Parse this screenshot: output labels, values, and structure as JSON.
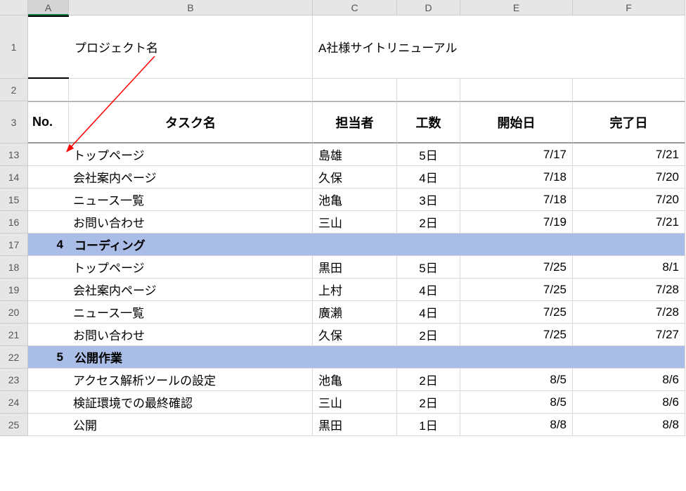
{
  "columns": [
    "A",
    "B",
    "C",
    "D",
    "E",
    "F"
  ],
  "project_label": "プロジェクト名",
  "project_name": "A社様サイトリニューアル",
  "header": {
    "no": "No.",
    "task": "タスク名",
    "assignee": "担当者",
    "effort": "工数",
    "start": "開始日",
    "end": "完了日"
  },
  "visible_rows": [
    "1",
    "2",
    "3",
    "13",
    "14",
    "15",
    "16",
    "17",
    "18",
    "19",
    "20",
    "21",
    "22",
    "23",
    "24",
    "25"
  ],
  "rows": [
    {
      "type": "data",
      "task": "トップページ",
      "assignee": "島雄",
      "effort": "5日",
      "start": "7/17",
      "end": "7/21"
    },
    {
      "type": "data",
      "task": "会社案内ページ",
      "assignee": "久保",
      "effort": "4日",
      "start": "7/18",
      "end": "7/20"
    },
    {
      "type": "data",
      "task": "ニュース一覧",
      "assignee": "池亀",
      "effort": "3日",
      "start": "7/18",
      "end": "7/20"
    },
    {
      "type": "data",
      "task": "お問い合わせ",
      "assignee": "三山",
      "effort": "2日",
      "start": "7/19",
      "end": "7/21"
    },
    {
      "type": "section",
      "no": "4",
      "task": "コーディング"
    },
    {
      "type": "data",
      "task": "トップページ",
      "assignee": "黒田",
      "effort": "5日",
      "start": "7/25",
      "end": "8/1"
    },
    {
      "type": "data",
      "task": "会社案内ページ",
      "assignee": "上村",
      "effort": "4日",
      "start": "7/25",
      "end": "7/28"
    },
    {
      "type": "data",
      "task": "ニュース一覧",
      "assignee": "廣瀨",
      "effort": "4日",
      "start": "7/25",
      "end": "7/28"
    },
    {
      "type": "data",
      "task": "お問い合わせ",
      "assignee": "久保",
      "effort": "2日",
      "start": "7/25",
      "end": "7/27"
    },
    {
      "type": "section",
      "no": "5",
      "task": "公開作業"
    },
    {
      "type": "data",
      "task": "アクセス解析ツールの設定",
      "assignee": "池亀",
      "effort": "2日",
      "start": "8/5",
      "end": "8/6"
    },
    {
      "type": "data",
      "task": "検証環境での最終確認",
      "assignee": "三山",
      "effort": "2日",
      "start": "8/5",
      "end": "8/6"
    },
    {
      "type": "data",
      "task": "公開",
      "assignee": "黒田",
      "effort": "1日",
      "start": "8/8",
      "end": "8/8"
    }
  ]
}
